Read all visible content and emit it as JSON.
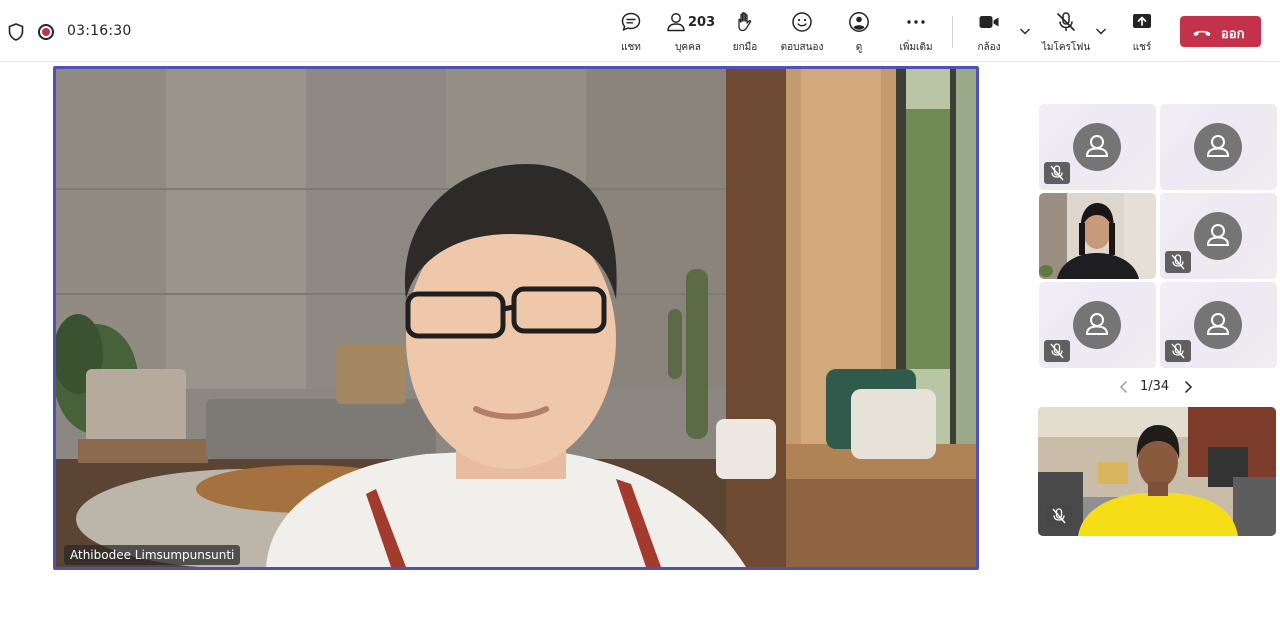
{
  "status": {
    "timer": "03:16:30"
  },
  "toolbar": {
    "chat_label": "แชท",
    "people_label": "บุคคล",
    "people_count": "203",
    "raise_label": "ยกมือ",
    "react_label": "ตอบสนอง",
    "view_label": "ดู",
    "more_label": "เพิ่มเติม",
    "camera_label": "กล้อง",
    "mic_label": "ไมโครโฟน",
    "share_label": "แชร์",
    "leave_label": "ออก"
  },
  "main_video": {
    "speaker_name": "Athibodee Limsumpunsunti"
  },
  "gallery": {
    "page_indicator": "1/34"
  },
  "colors": {
    "leave": "#c4314b",
    "active_speaker_border": "#4f52b2",
    "avatar": "#757575"
  },
  "icons": [
    "shield-icon",
    "recording-icon",
    "chat-icon",
    "people-icon",
    "hand-icon",
    "emoji-icon",
    "view-icon",
    "more-icon",
    "camera-icon",
    "mic-off-icon",
    "share-icon",
    "phone-hangup-icon",
    "chevron-left-icon",
    "chevron-right-icon"
  ]
}
